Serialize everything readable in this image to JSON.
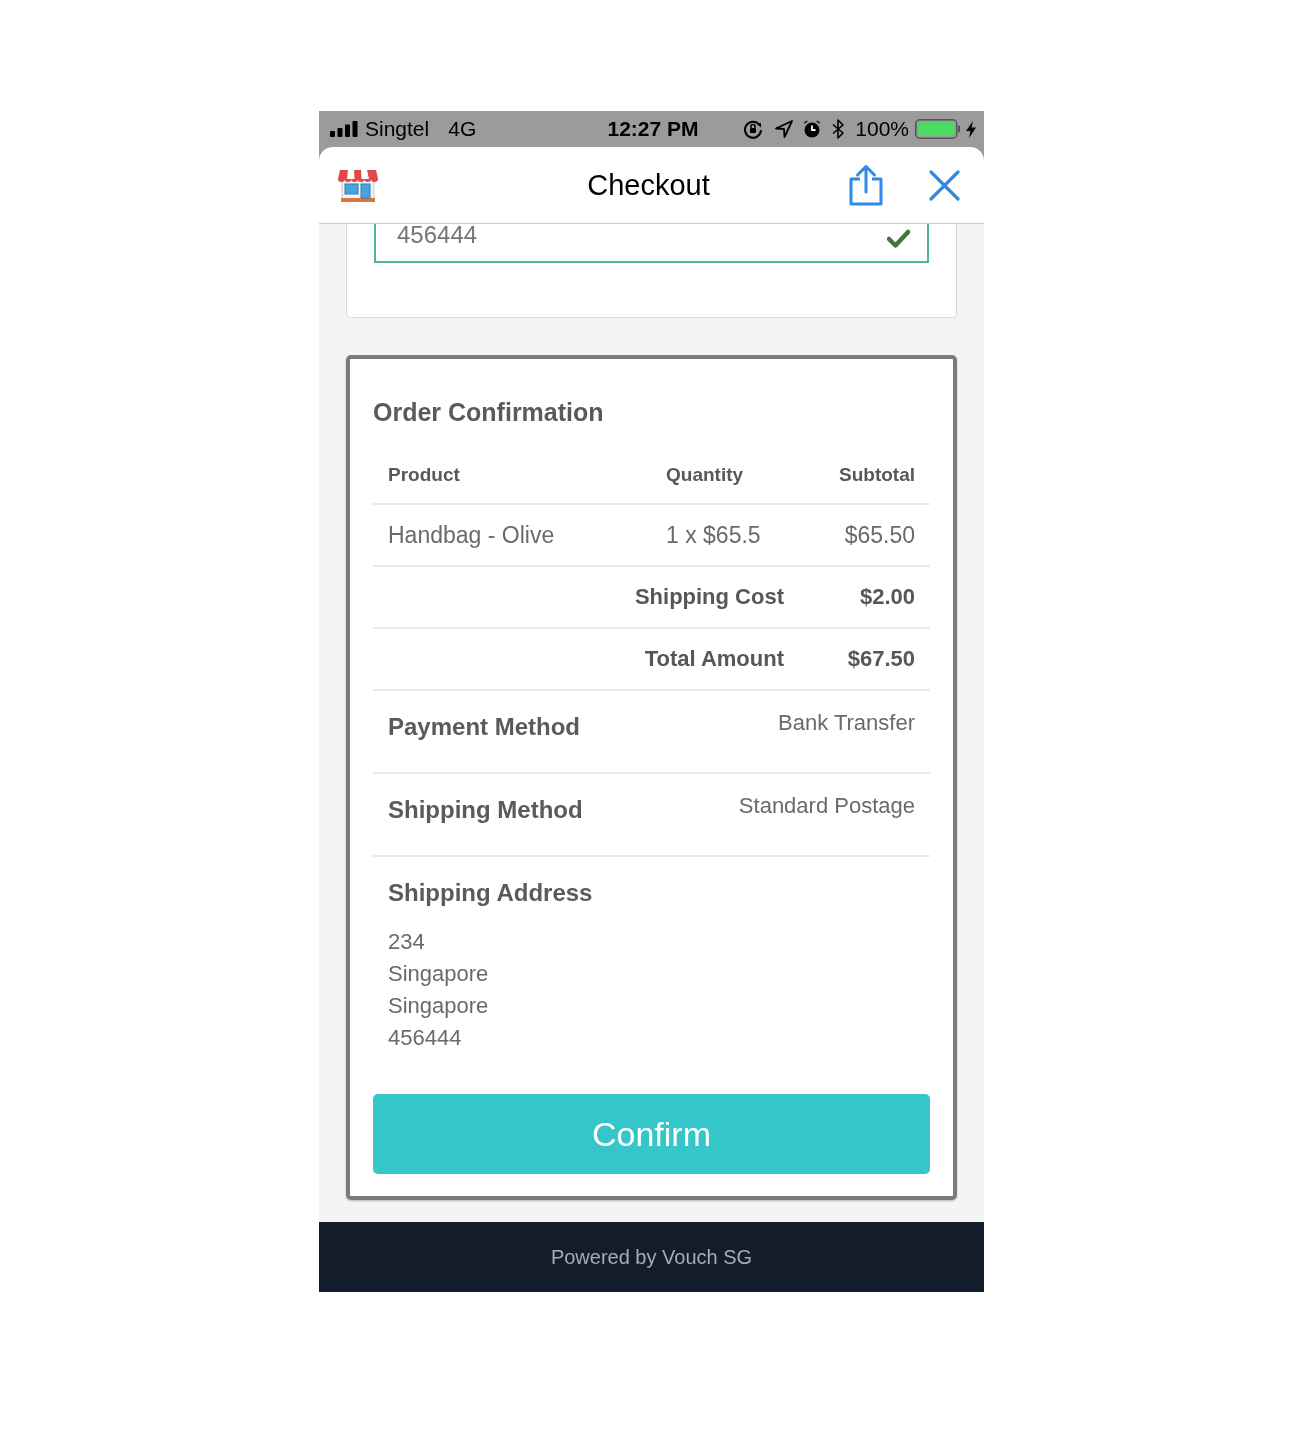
{
  "status_bar": {
    "carrier": "Singtel",
    "network": "4G",
    "time": "12:27 PM",
    "battery": "100%"
  },
  "header": {
    "title": "Checkout"
  },
  "form_card": {
    "field": {
      "value": "456444",
      "valid": true
    }
  },
  "order": {
    "title": "Order Confirmation",
    "columns": [
      "Product",
      "Quantity",
      "Subtotal"
    ],
    "items": [
      {
        "product": "Handbag - Olive",
        "quantity": "1 x $65.5",
        "subtotal": "$65.50"
      }
    ],
    "totals": [
      {
        "label": "Shipping Cost",
        "value": "$2.00"
      },
      {
        "label": "Total Amount",
        "value": "$67.50"
      }
    ],
    "details": [
      {
        "label": "Payment Method",
        "value": "Bank Transfer"
      },
      {
        "label": "Shipping Method",
        "value": "Standard Postage"
      }
    ],
    "address": {
      "label": "Shipping Address",
      "lines": [
        "234",
        "Singapore",
        "Singapore",
        "456444"
      ]
    },
    "confirm_button": "Confirm"
  },
  "footer": {
    "text": "Powered by Vouch SG"
  }
}
